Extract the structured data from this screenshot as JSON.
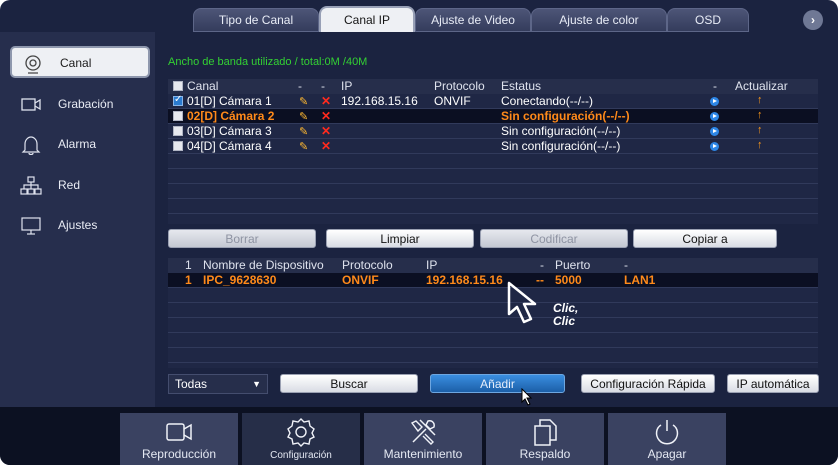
{
  "tabs": [
    {
      "label": "Tipo de Canal"
    },
    {
      "label": "Canal IP"
    },
    {
      "label": "Ajuste de Video"
    },
    {
      "label": "Ajuste de color"
    },
    {
      "label": "OSD"
    }
  ],
  "tab_next": "›",
  "sidebar": {
    "items": [
      {
        "label": "Canal"
      },
      {
        "label": "Grabación"
      },
      {
        "label": "Alarma"
      },
      {
        "label": "Red"
      },
      {
        "label": "Ajustes"
      }
    ]
  },
  "bandwidth_text": "Ancho de banda utilizado / total:0M /40M",
  "channels": {
    "headers": {
      "canal": "Canal",
      "dash1": "-",
      "dash2": "-",
      "ip": "IP",
      "protocolo": "Protocolo",
      "estatus": "Estatus",
      "dash3": "-",
      "actualizar": "Actualizar"
    },
    "rows": [
      {
        "canal": "01[D] Cámara 1",
        "ip": "192.168.15.16",
        "protocolo": "ONVIF",
        "estatus": "Conectando(--/--)"
      },
      {
        "canal": "02[D] Cámara 2",
        "ip": "",
        "protocolo": "",
        "estatus": "Sin configuración(--/--)"
      },
      {
        "canal": "03[D] Cámara 3",
        "ip": "",
        "protocolo": "",
        "estatus": "Sin configuración(--/--)"
      },
      {
        "canal": "04[D] Cámara 4",
        "ip": "",
        "protocolo": "",
        "estatus": "Sin configuración(--/--)"
      }
    ]
  },
  "buttons1": {
    "borrar": "Borrar",
    "limpiar": "Limpiar",
    "codificar": "Codificar",
    "copiar": "Copiar a"
  },
  "devices": {
    "headers": {
      "num": "1",
      "nombre": "Nombre de Dispositivo",
      "protocolo": "Protocolo",
      "ip": "IP",
      "dash": "-",
      "puerto": "Puerto",
      "dash2": "-"
    },
    "rows": [
      {
        "num": "1",
        "nombre": "IPC_9628630",
        "protocolo": "ONVIF",
        "ip": "192.168.15.16",
        "dash": "--",
        "puerto": "5000",
        "red": "LAN1"
      }
    ]
  },
  "filter": {
    "value": "Todas"
  },
  "buttons2": {
    "buscar": "Buscar",
    "anadir": "Añadir",
    "config_rapida": "Configuración Rápida",
    "ip_auto": "IP automática"
  },
  "annotation": {
    "line1": "Clic,",
    "line2": "Clic"
  },
  "bottom": [
    {
      "label": "Reproducción"
    },
    {
      "label": "Configuración"
    },
    {
      "label": "Mantenimiento"
    },
    {
      "label": "Respaldo"
    },
    {
      "label": "Apagar"
    }
  ]
}
